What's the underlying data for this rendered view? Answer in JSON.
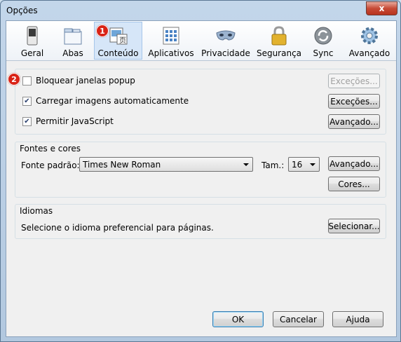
{
  "window": {
    "title": "Opções",
    "close_label": "x"
  },
  "toolbar": {
    "tabs": [
      {
        "label": "Geral"
      },
      {
        "label": "Abas"
      },
      {
        "label": "Conteúdo"
      },
      {
        "label": "Aplicativos"
      },
      {
        "label": "Privacidade"
      },
      {
        "label": "Segurança"
      },
      {
        "label": "Sync"
      },
      {
        "label": "Avançado"
      }
    ],
    "active_tab": "Conteúdo"
  },
  "badges": {
    "one": "1",
    "two": "2"
  },
  "content": {
    "block_popups": {
      "label": "Bloquear janelas popup",
      "checked": false,
      "exceptions_label": "Exceções..."
    },
    "load_images": {
      "label": "Carregar imagens automaticamente",
      "checked": true,
      "exceptions_label": "Exceções..."
    },
    "javascript": {
      "label": "Permitir JavaScript",
      "checked": true,
      "advanced_label": "Avançado..."
    }
  },
  "fonts": {
    "group_title": "Fontes e cores",
    "default_font_label": "Fonte padrão:",
    "default_font_value": "Times New Roman",
    "size_label": "Tam.:",
    "size_value": "16",
    "advanced_label": "Avançado...",
    "colors_label": "Cores..."
  },
  "languages": {
    "group_title": "Idiomas",
    "description": "Selecione o idioma preferencial para páginas.",
    "select_label": "Selecionar..."
  },
  "footer": {
    "ok_label": "OK",
    "cancel_label": "Cancelar",
    "help_label": "Ajuda"
  },
  "colors": {
    "badge": "#d92316",
    "active_tab_bg": "#d6e6f8",
    "window_chrome": "#c3d6ea"
  }
}
